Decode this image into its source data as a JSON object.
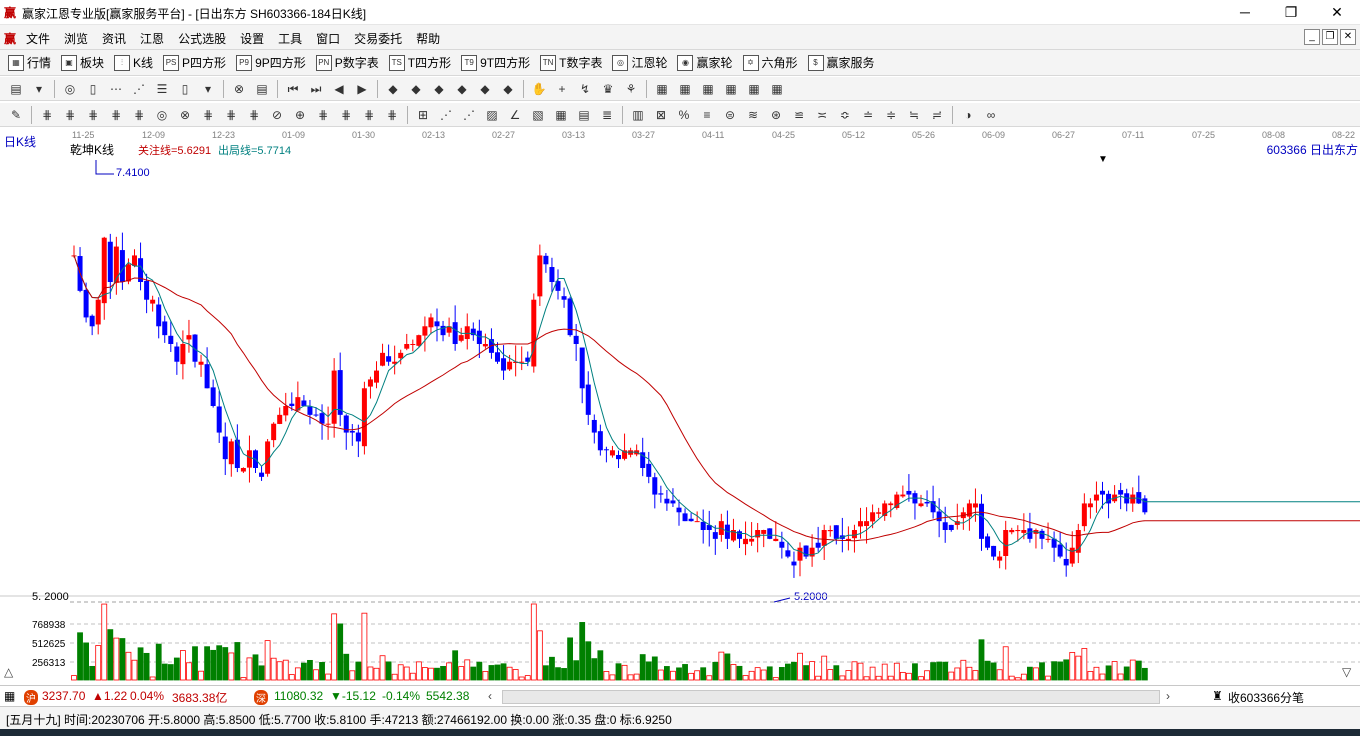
{
  "window": {
    "title": "赢家江恩专业版[赢家服务平台] - [日出东方  SH603366-184日K线]",
    "app_icon": "赢",
    "minimize": "─",
    "maximize": "❐",
    "close": "✕"
  },
  "menu": {
    "logo": "赢",
    "items": [
      "文件",
      "浏览",
      "资讯",
      "江恩",
      "公式选股",
      "设置",
      "工具",
      "窗口",
      "交易委托",
      "帮助"
    ],
    "mdi_buttons": [
      "_",
      "❐",
      "✕"
    ]
  },
  "toolbar": {
    "items": [
      {
        "icon": "▦",
        "label": "行情"
      },
      {
        "icon": "▣",
        "label": "板块"
      },
      {
        "icon": "⫶",
        "label": "K线"
      },
      {
        "icon": "PS",
        "label": "P四方形"
      },
      {
        "icon": "P9",
        "label": "9P四方形"
      },
      {
        "icon": "PN",
        "label": "P数字表"
      },
      {
        "icon": "TS",
        "label": "T四方形"
      },
      {
        "icon": "T9",
        "label": "9T四方形"
      },
      {
        "icon": "TN",
        "label": "T数字表"
      },
      {
        "icon": "◎",
        "label": "江恩轮"
      },
      {
        "icon": "◉",
        "label": "赢家轮"
      },
      {
        "icon": "✡",
        "label": "六角形"
      },
      {
        "icon": "$",
        "label": "赢家服务"
      }
    ]
  },
  "toolbar2_glyphs": [
    "▤",
    "▾",
    "|",
    "◎",
    "▯",
    "⋯",
    "⋰",
    "☰",
    "▯",
    "▾",
    "|",
    "⊗",
    "▤",
    "|",
    "⏮",
    "⏭",
    "◀",
    "▶",
    "|",
    "◆",
    "◆",
    "◆",
    "◆",
    "◆",
    "◆",
    "|",
    "✋",
    "+",
    "↯",
    "♛",
    "⚘",
    "|",
    "▦",
    "▦",
    "▦",
    "▦",
    "▦",
    "▦"
  ],
  "toolbar3_glyphs": [
    "✎",
    "|",
    "⋕",
    "⋕",
    "⋕",
    "⋕",
    "⋕",
    "◎",
    "⊗",
    "⋕",
    "⋕",
    "⋕",
    "⊘",
    "⊕",
    "⋕",
    "⋕",
    "⋕",
    "⋕",
    "|",
    "⊞",
    "⋰",
    "⋰",
    "▨",
    "∠",
    "▧",
    "▦",
    "▤",
    "≣",
    "|",
    "▥",
    "⊠",
    "%",
    "≡",
    "⊜",
    "≋",
    "⊛",
    "≌",
    "≍",
    "≎",
    "≐",
    "≑",
    "≒",
    "≓",
    "|",
    "◑",
    "∞"
  ],
  "chart_data": {
    "type": "candlestick",
    "period_label": "日K线",
    "indicator_label": "乾坤K线",
    "focus_line_label": "关注线=5.6291",
    "exit_line_label": "出局线=5.7714",
    "stock_label": "603366  日出东方",
    "date_ticks": [
      "11-25",
      "12-09",
      "12-23",
      "01-09",
      "01-30",
      "02-13",
      "02-27",
      "03-13",
      "03-27",
      "04-11",
      "04-25",
      "05-12",
      "05-26",
      "06-09",
      "06-27",
      "07-11",
      "07-25",
      "08-08",
      "08-22"
    ],
    "high_label": "7.4100",
    "low_label": "5.2000",
    "price_axis_label": "5. 2000",
    "volume_axis_labels": [
      "768938",
      "512625",
      "256313"
    ],
    "price_range": [
      5.05,
      7.5
    ],
    "volume_max": 1025250,
    "colors": {
      "up": "#ff0000",
      "down": "#0000ff",
      "neutral": "#800080",
      "ma_fast": "#008080",
      "ma_slow": "#c00000",
      "volume": "#008000"
    },
    "closes": [
      6.95,
      6.75,
      6.6,
      6.55,
      6.7,
      7.05,
      6.8,
      7.0,
      6.8,
      6.9,
      6.95,
      6.8,
      6.7,
      6.7,
      6.55,
      6.5,
      6.45,
      6.35,
      6.45,
      6.5,
      6.35,
      6.35,
      6.2,
      6.1,
      5.95,
      5.8,
      5.9,
      5.75,
      5.75,
      5.85,
      5.75,
      5.7,
      5.9,
      6.0,
      6.05,
      6.1,
      6.1,
      6.15,
      6.1,
      6.05,
      6.05,
      6.0,
      6.0,
      6.3,
      6.05,
      5.95,
      5.95,
      5.9,
      6.2,
      6.25,
      6.3,
      6.4,
      6.35,
      6.35,
      6.4,
      6.45,
      6.45,
      6.5,
      6.55,
      6.6,
      6.55,
      6.5,
      6.55,
      6.45,
      6.5,
      6.55,
      6.5,
      6.45,
      6.45,
      6.4,
      6.35,
      6.3,
      6.35,
      6.35,
      6.35,
      6.35,
      6.7,
      6.95,
      6.9,
      6.8,
      6.75,
      6.7,
      6.5,
      6.45,
      6.2,
      6.05,
      5.95,
      5.85,
      5.85,
      5.85,
      5.8,
      5.85,
      5.85,
      5.85,
      5.75,
      5.7,
      5.6,
      5.6,
      5.55,
      5.55,
      5.5,
      5.45,
      5.45,
      5.45,
      5.4,
      5.4,
      5.35,
      5.45,
      5.35,
      5.4,
      5.35,
      5.35,
      5.35,
      5.4,
      5.4,
      5.35,
      5.35,
      5.3,
      5.25,
      5.2,
      5.3,
      5.25,
      5.3,
      5.3,
      5.4,
      5.4,
      5.35,
      5.35,
      5.35,
      5.4,
      5.45,
      5.45,
      5.5,
      5.5,
      5.55,
      5.55,
      5.6,
      5.6,
      5.6,
      5.55,
      5.55,
      5.55,
      5.5,
      5.45,
      5.4,
      5.4,
      5.45,
      5.5,
      5.55,
      5.55,
      5.35,
      5.3,
      5.25,
      5.25,
      5.4,
      5.4,
      5.4,
      5.4,
      5.35,
      5.4,
      5.35,
      5.35,
      5.3,
      5.25,
      5.2,
      5.3,
      5.4,
      5.55,
      5.55,
      5.6,
      5.6,
      5.55,
      5.6,
      5.6,
      5.55,
      5.6,
      5.55,
      5.5
    ],
    "last_bar_info": "[五月十九] 时间:20230706 开:5.8000 高:5.8500 低:5.7700 收:5.8100 手:47213 额:27466192.00 换:0.00 涨:0.35 盘:0 标:6.9250"
  },
  "status": {
    "index1_value": "3237.70",
    "index1_change": "▲1.22",
    "index1_pct": "0.04%",
    "index1_amount": "3683.38亿",
    "index2_value": "11080.32",
    "index2_change": "▼-15.12",
    "index2_pct": "-0.14%",
    "index2_amount": "5542.38",
    "right_label": "收603366分笔",
    "info_line": "[五月十九] 时间:20230706 开:5.8000 高:5.8500 低:5.7700 收:5.8100 手:47213 额:27466192.00 换:0.00 涨:0.35 盘:0 标:6.9250"
  }
}
